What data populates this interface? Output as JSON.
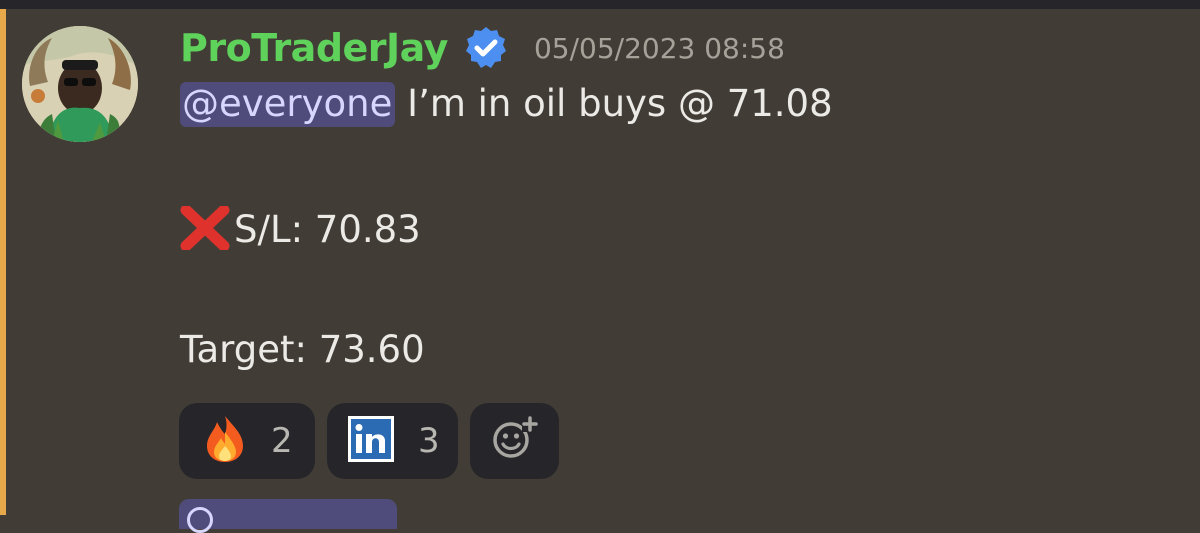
{
  "message": {
    "author": {
      "username": "ProTraderJay",
      "verified_icon": "verified-badge-icon",
      "avatar_icon": "avatar-image"
    },
    "timestamp": "05/05/2023 08:58",
    "mention": "@everyone",
    "line1_text": " I’m in oil buys  @ 71.08",
    "stop_loss": "S/L: 70.83",
    "target": "Target: 73.60"
  },
  "reactions": [
    {
      "icon": "fire-emoji-icon",
      "count": "2"
    },
    {
      "icon": "linkedin-icon",
      "count": "3"
    },
    {
      "icon": "add-reaction-icon"
    }
  ],
  "colors": {
    "background": "#413d36",
    "username": "#5fd25b",
    "highlight_bar": "#e8a94a",
    "mention_bg": "#4f4b7b",
    "reaction_bg": "#26262a"
  }
}
